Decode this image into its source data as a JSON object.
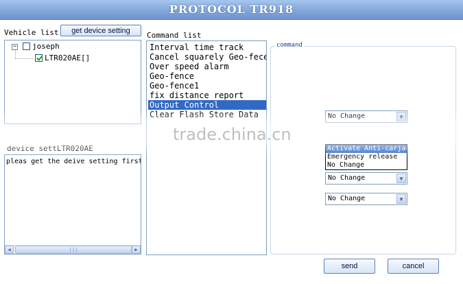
{
  "window": {
    "title": "PROTOCOL TR918"
  },
  "vehicle_panel": {
    "label": "Vehicle list",
    "get_setting_button": "get device setting",
    "tree": [
      {
        "name": "joseph",
        "expanded": true,
        "checked": false,
        "toggle": "−"
      },
      {
        "name": "LTR020AE[]",
        "checked": true
      }
    ]
  },
  "device_setting": {
    "label": "device settLTR020AE",
    "text": "pleas get the deive setting first"
  },
  "command_list": {
    "label": "Command list",
    "items": [
      "Interval time track",
      "Cancel squarely Geo-fece",
      "Over speed alarm",
      "Geo-fence",
      "Geo-fence1",
      "fix distance report",
      "Output Control",
      "Clear Flash Store Data"
    ],
    "selected_index": 6
  },
  "command_panel": {
    "legend": "command",
    "selects": [
      {
        "value": "No Change"
      },
      {
        "value": "Activate Anti-carjack"
      },
      {
        "value": "No Change"
      },
      {
        "value": "No Change"
      }
    ],
    "dropdown_options": [
      "Activate Anti-carjack",
      "Emergency release",
      "No Change"
    ],
    "dropdown_highlight": 0
  },
  "footer": {
    "send_label": "send",
    "cancel_label": "cancel"
  },
  "watermark": {
    "text": "trade.china.cn"
  },
  "icons": {
    "dropdown_arrow": "▼",
    "scroll_left": "◀",
    "scroll_right": "▶",
    "thumb_grip": "|||"
  }
}
